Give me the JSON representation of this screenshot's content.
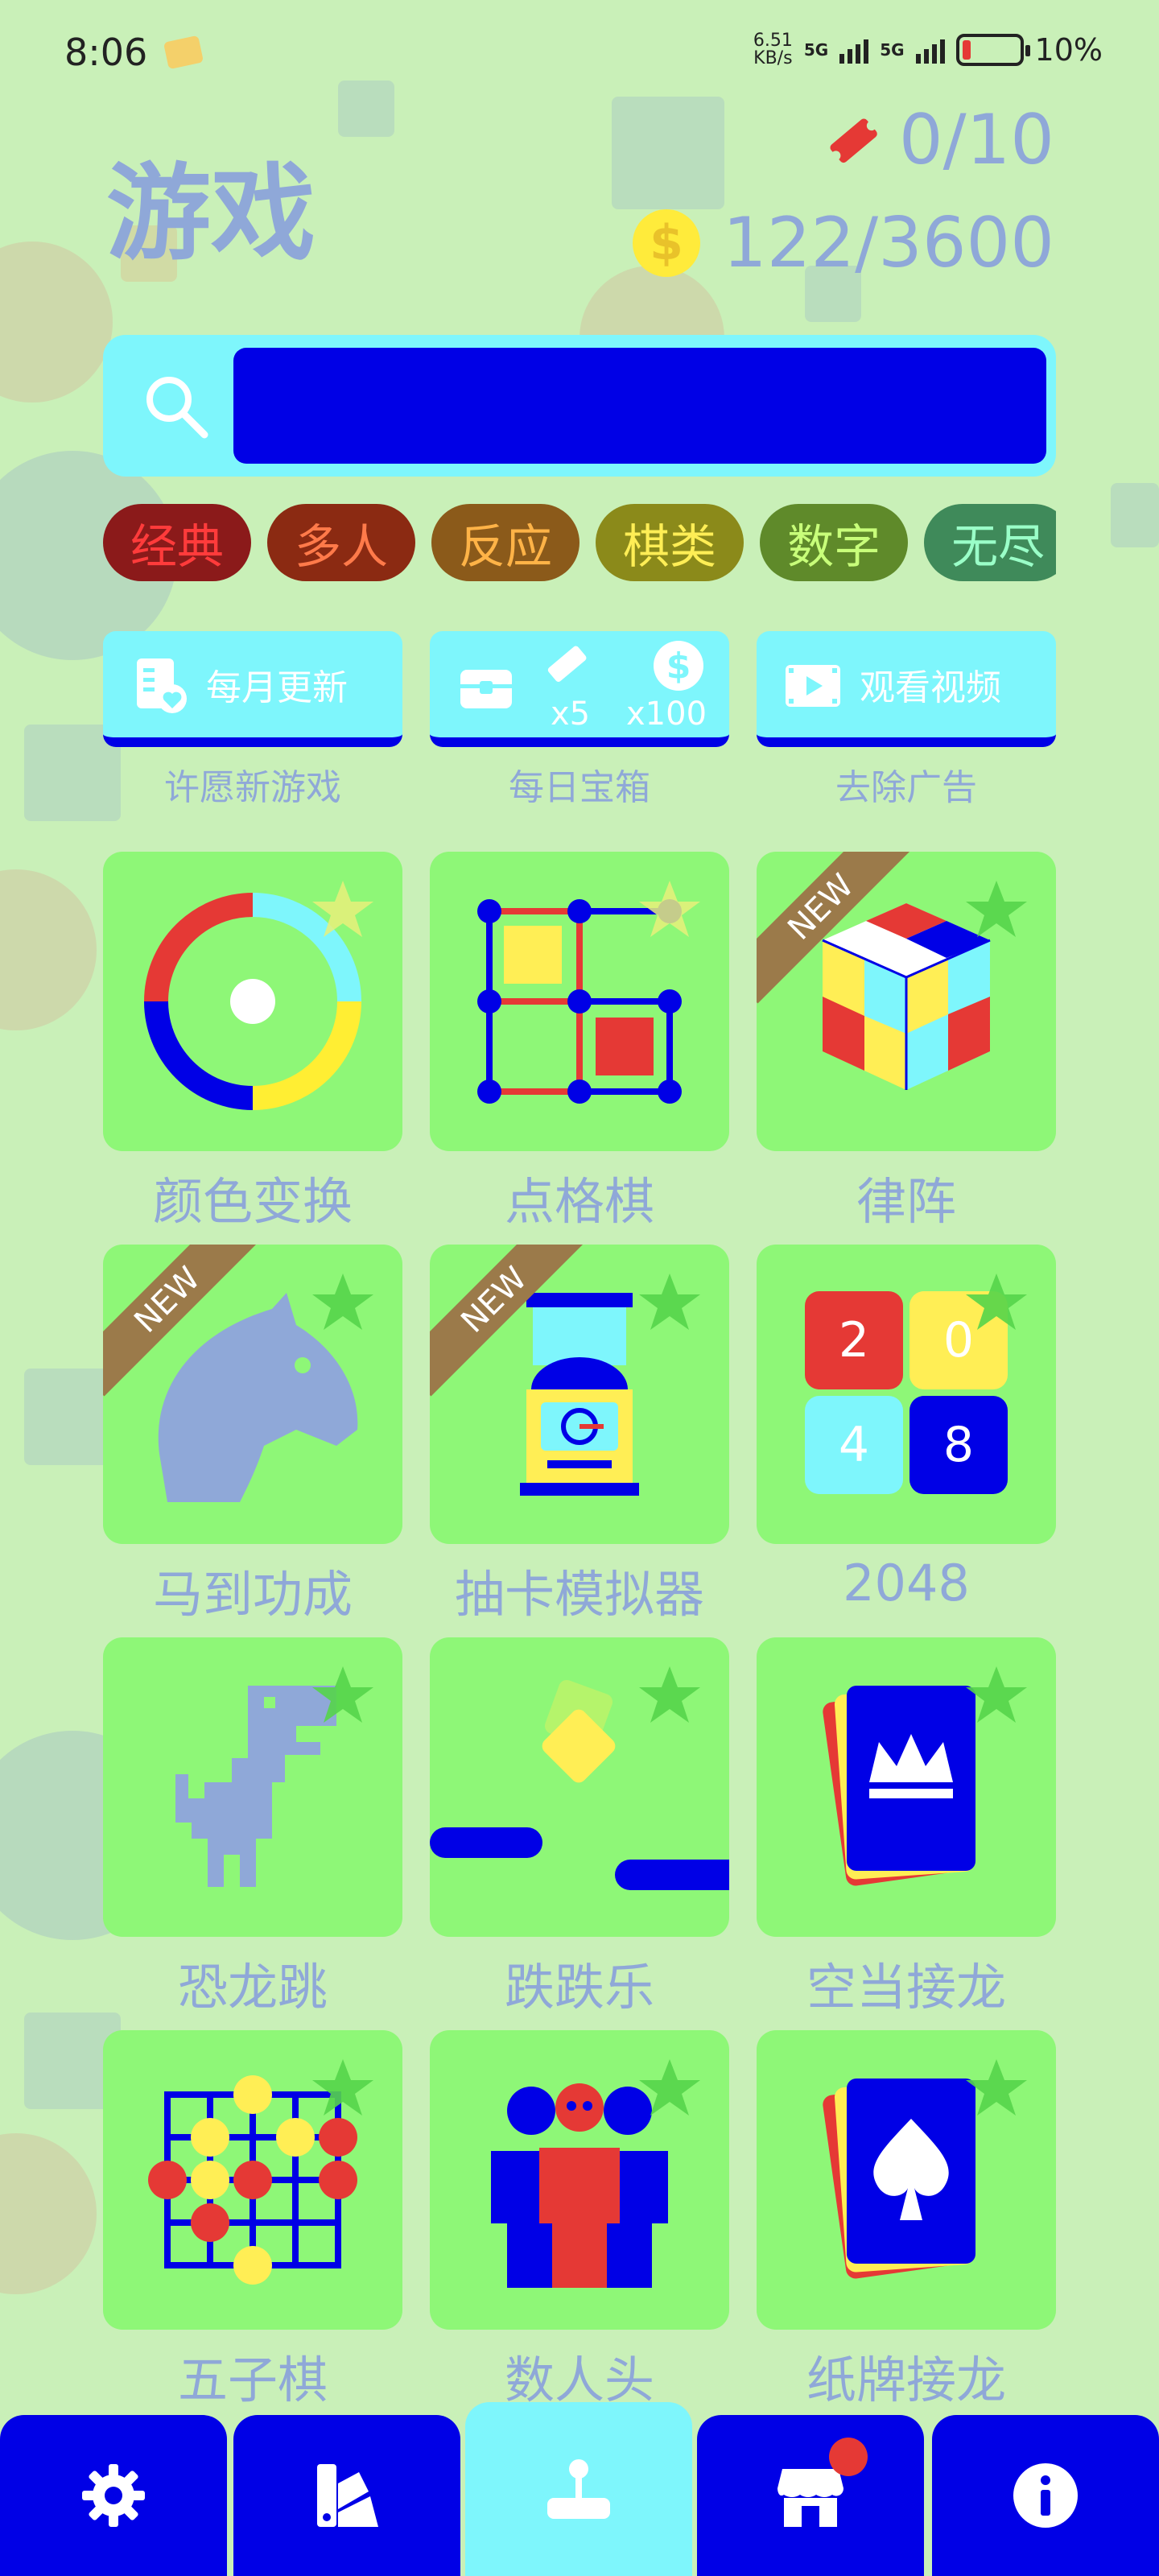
{
  "status_bar": {
    "time": "8:06",
    "speed_value": "6.51",
    "speed_unit": "KB/s",
    "network1": "5G",
    "network2": "5G",
    "battery": "10%"
  },
  "header": {
    "title": "游戏",
    "tickets": "0/10",
    "coin_symbol": "$",
    "coins": "122/3600"
  },
  "search": {
    "placeholder": ""
  },
  "categories": [
    {
      "label": "经典",
      "bg": "#8b1a1a",
      "fg": "#ff3b3b"
    },
    {
      "label": "多人",
      "bg": "#8b2a12",
      "fg": "#ff7a4a"
    },
    {
      "label": "反应",
      "bg": "#8b5a1a",
      "fg": "#ffb347"
    },
    {
      "label": "棋类",
      "bg": "#8b8a1a",
      "fg": "#ffee55"
    },
    {
      "label": "数字",
      "bg": "#5f8a2a",
      "fg": "#c8ff7a"
    },
    {
      "label": "无尽",
      "bg": "#3f8a5a",
      "fg": "#9affc8"
    }
  ],
  "actions": [
    {
      "label": "每月更新",
      "caption": "许愿新游戏",
      "icon": "wishlist-icon"
    },
    {
      "label_left": "x5",
      "label_right": "x100",
      "caption": "每日宝箱",
      "icon": "treasure-chest-icon"
    },
    {
      "label": "观看视频",
      "caption": "去除广告",
      "icon": "video-icon"
    }
  ],
  "new_badge": "NEW",
  "games": [
    {
      "name": "颜色变换",
      "icon": "color-switch-icon",
      "is_new": false
    },
    {
      "name": "点格棋",
      "icon": "dots-boxes-icon",
      "is_new": false
    },
    {
      "name": "律阵",
      "icon": "music-cube-icon",
      "is_new": true
    },
    {
      "name": "马到功成",
      "icon": "horse-head-icon",
      "is_new": true
    },
    {
      "name": "抽卡模拟器",
      "icon": "gacha-machine-icon",
      "is_new": true
    },
    {
      "name": "2048",
      "icon": "2048-tiles-icon",
      "is_new": false,
      "tiles": [
        "2",
        "0",
        "4",
        "8"
      ]
    },
    {
      "name": "恐龙跳",
      "icon": "dinosaur-icon",
      "is_new": false
    },
    {
      "name": "跌跌乐",
      "icon": "falling-block-icon",
      "is_new": false
    },
    {
      "name": "空当接龙",
      "icon": "crown-card-icon",
      "is_new": false
    },
    {
      "name": "五子棋",
      "icon": "gomoku-board-icon",
      "is_new": false
    },
    {
      "name": "数人头",
      "icon": "people-count-icon",
      "is_new": false
    },
    {
      "name": "纸牌接龙",
      "icon": "spade-card-icon",
      "is_new": false
    }
  ],
  "nav": [
    {
      "icon": "gear-icon",
      "active": false
    },
    {
      "icon": "color-palette-icon",
      "active": false
    },
    {
      "icon": "joystick-icon",
      "active": true
    },
    {
      "icon": "store-icon",
      "active": false,
      "badge": true
    },
    {
      "icon": "info-icon",
      "active": false
    }
  ],
  "colors": {
    "background": "#c9f0b8",
    "accent_blue": "#0000e6",
    "accent_cyan": "#7ef6fc",
    "tile_green": "#8ef777",
    "label_gray_blue": "#8fa8d8"
  }
}
